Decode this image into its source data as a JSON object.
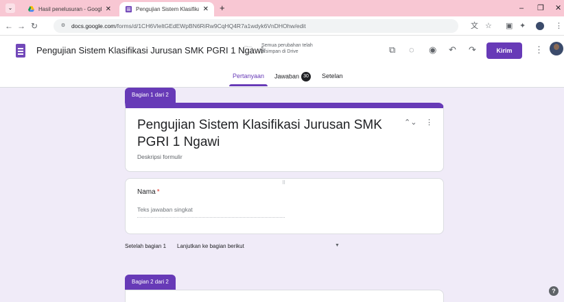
{
  "browser": {
    "tabs": [
      {
        "title": "Hasil penelusuran - Google Dri",
        "close": "✕"
      },
      {
        "title": "Pengujian Sistem Klasifikasi Jur",
        "close": "✕"
      }
    ],
    "new_tab": "+",
    "url_domain": "docs.google.com",
    "url_path": "/forms/d/1CH6VleltGEdEWpBN6RiRw9CqHQ4R7a1wdyk6VnDHOhw/edit"
  },
  "header": {
    "doc_title": "Pengujian Sistem Klasifikasi Jurusan SMK PGRI 1 Ngawi",
    "save_status": "Semua perubahan telah disimpan di Drive",
    "send_label": "Kirim",
    "tabs": {
      "questions": "Pertanyaan",
      "responses": "Jawaban",
      "responses_count": "30",
      "settings": "Setelan"
    }
  },
  "form": {
    "section1_tag": "Bagian 1 dari 2",
    "title": "Pengujian Sistem Klasifikasi Jurusan SMK PGRI 1 Ngawi",
    "description_placeholder": "Deskripsi formulir",
    "question": {
      "label": "Nama",
      "required_mark": "*",
      "answer_placeholder": "Teks jawaban singkat"
    },
    "after_section_label": "Setelah bagian 1",
    "after_section_value": "Lanjutkan ke bagian berikut",
    "section2_tag": "Bagian 2 dari 2"
  },
  "colors": {
    "accent": "#673ab7",
    "background": "#f0ebf8",
    "tabstrip": "#f8c7d3"
  },
  "icons": {
    "tab_menu": "chevron-down-icon",
    "folder": "folder-icon",
    "star": "star-icon",
    "addons": "puzzle-icon",
    "palette": "palette-icon",
    "preview": "eye-icon",
    "undo": "undo-icon",
    "redo": "redo-icon",
    "more": "more-vert-icon",
    "help": "help-icon"
  }
}
